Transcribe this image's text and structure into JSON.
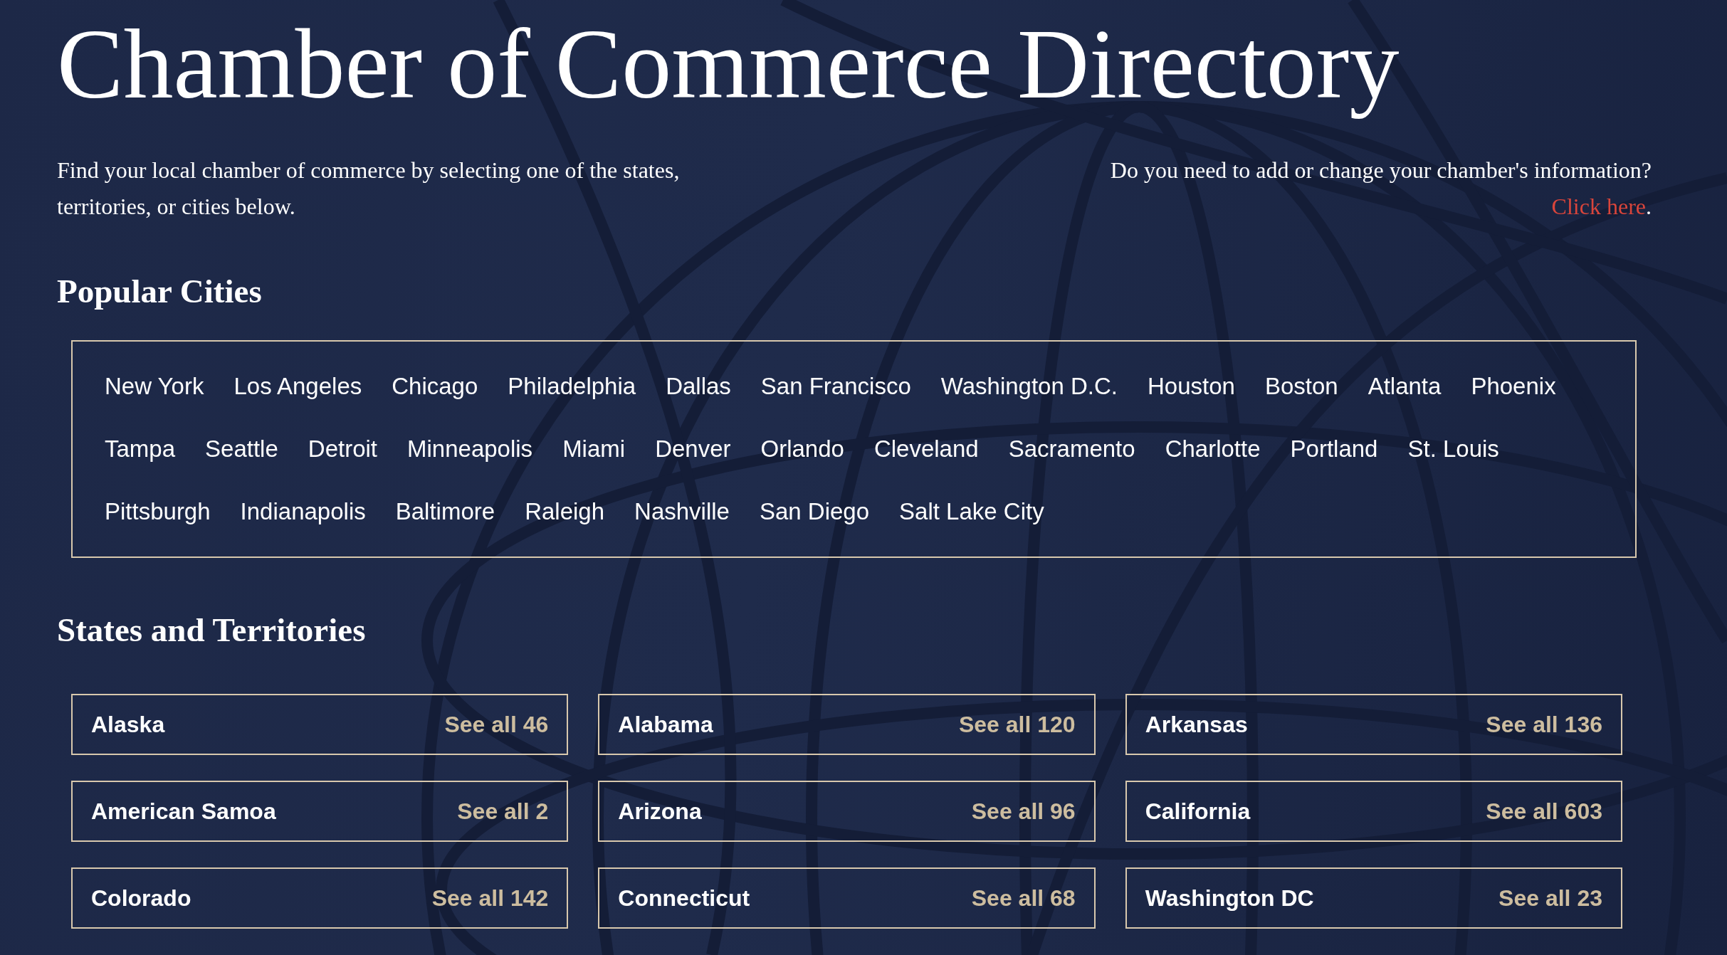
{
  "page": {
    "title": "Chamber of Commerce Directory"
  },
  "intro": {
    "text": "Find your local chamber of commerce by selecting one of the states, territories, or cities below."
  },
  "update_notice": {
    "text": "Do you need to add or change your chamber's information?",
    "link": "Click here",
    "link_suffix": "."
  },
  "popular_cities": {
    "heading": "Popular Cities",
    "cities": [
      "New York",
      "Los Angeles",
      "Chicago",
      "Philadelphia",
      "Dallas",
      "San Francisco",
      "Washington D.C.",
      "Houston",
      "Boston",
      "Atlanta",
      "Phoenix",
      "Tampa",
      "Seattle",
      "Detroit",
      "Minneapolis",
      "Miami",
      "Denver",
      "Orlando",
      "Cleveland",
      "Sacramento",
      "Charlotte",
      "Portland",
      "St. Louis",
      "Pittsburgh",
      "Indianapolis",
      "Baltimore",
      "Raleigh",
      "Nashville",
      "San Diego",
      "Salt Lake City"
    ]
  },
  "states_and_territories": {
    "heading": "States and Territories",
    "items": [
      {
        "name": "Alaska",
        "link": "See all 46"
      },
      {
        "name": "Alabama",
        "link": "See all 120"
      },
      {
        "name": "Arkansas",
        "link": "See all 136"
      },
      {
        "name": "American Samoa",
        "link": "See all 2"
      },
      {
        "name": "Arizona",
        "link": "See all 96"
      },
      {
        "name": "California",
        "link": "See all 603"
      },
      {
        "name": "Colorado",
        "link": "See all 142"
      },
      {
        "name": "Connecticut",
        "link": "See all 68"
      },
      {
        "name": "Washington DC",
        "link": "See all 23"
      }
    ]
  }
}
